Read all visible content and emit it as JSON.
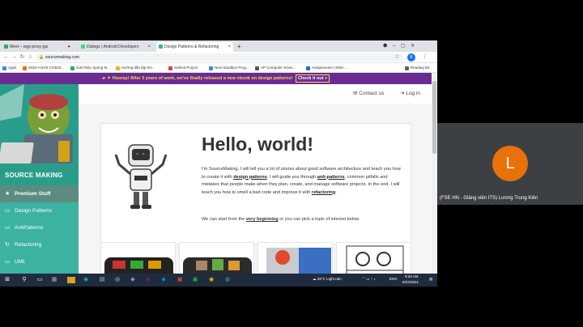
{
  "tabs": [
    {
      "label": "Meet – wgp-pnwy-jgs",
      "active": false
    },
    {
      "label": "Dialogs | Android Developers",
      "active": false
    },
    {
      "label": "Design Patterns & Refactoring",
      "active": true
    }
  ],
  "new_tab_label": "+",
  "address": "sourcemaking.com",
  "bookmarks": [
    "Apps",
    "2020-I+(KHI-CO520...",
    "Giải thiệu Spring M...",
    "Hướng dẫn lập trìn...",
    "Submit Project",
    "New Sandbox Prog...",
    "AP Computer Scien...",
    "Assignments | MSH...",
    "Reading list"
  ],
  "banner": {
    "text": "Hooray! After 3 years of work, we've finally released a new ebook on design patterns!",
    "cta": "Check it out »"
  },
  "sidebar": {
    "logo_text": "SOURCE MAKING",
    "items": [
      {
        "label": "Premium Stuff",
        "icon": "★"
      },
      {
        "label": "Design Patterns",
        "icon": "▭"
      },
      {
        "label": "AntiPatterns",
        "icon": "▭"
      },
      {
        "label": "Refactoring",
        "icon": "↻"
      },
      {
        "label": "UML",
        "icon": "▭"
      }
    ]
  },
  "topnav": {
    "contact": "Contact us",
    "login": "Log in"
  },
  "hero": {
    "title": "Hello, world!",
    "p1_a": "I'm SourceMaking. I will tell you a lot of stories about good software architecture and teach you how to create it with ",
    "p1_link1": "design patterns",
    "p1_b": ". I will guide you through ",
    "p1_link2": "anti-patterns",
    "p1_c": ", common pitfalls and mistakes that people make when they plan, create, and manage software projects. In the end, I will teach you how to smell a bad code and improve it with ",
    "p1_link3": "refactoring",
    "p1_d": ".",
    "p2_a": "We can start from the ",
    "p2_link": "very beginning",
    "p2_b": " or you can pick a topic of interest below."
  },
  "taskbar": {
    "weather": "29°C  Light rain",
    "lang": "ENG",
    "time": "9:26 AM",
    "date": "8/22/2021"
  },
  "meet": {
    "avatar_letter": "L",
    "participant": "(FSE HN - Giảng viên ITS) Lương Trung Kiên"
  },
  "colors": {
    "banner": "#6b2c91",
    "sidebar": "#3bb3a0",
    "avatar": "#e8710a"
  }
}
